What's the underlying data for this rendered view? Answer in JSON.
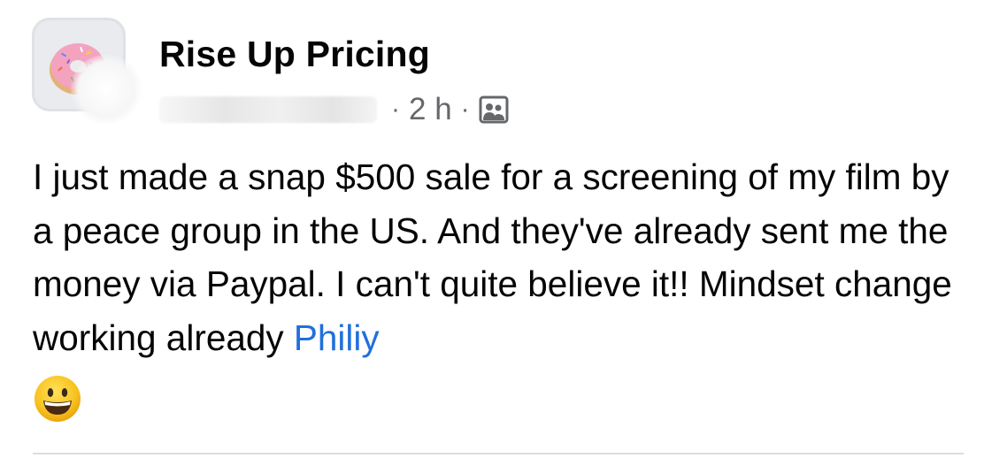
{
  "post": {
    "page_name": "Rise Up Pricing",
    "timestamp": "2 h",
    "separator": "·",
    "audience_icon": "group-audience-icon",
    "avatar_icon": "donut-avatar-icon",
    "text_main": "I just made a snap $500 sale for a screening of my film by a peace group in the US. And they've already sent me the money via Paypal. I can't quite believe it!! Mindset change working already ",
    "mention": "Philiy",
    "emoji": "grinning-face-icon"
  },
  "colors": {
    "text": "#050505",
    "secondary_text": "#65676b",
    "mention_blue": "#216fdb",
    "divider": "#dadde1"
  }
}
